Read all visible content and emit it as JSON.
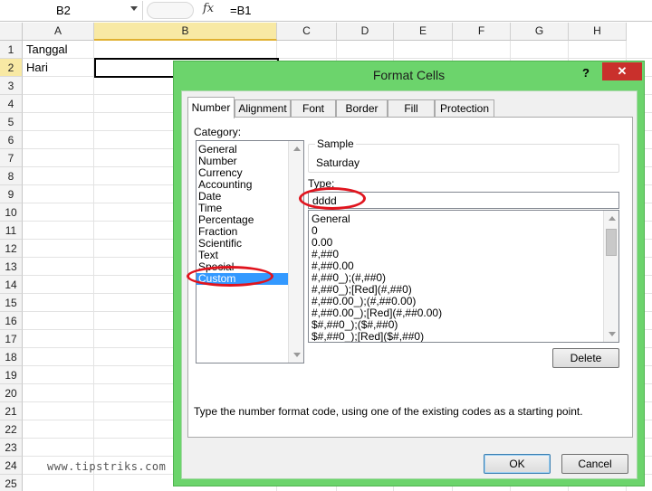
{
  "formula_bar": {
    "name_box": "B2",
    "fx_icon": "fx",
    "formula": "=B1"
  },
  "grid": {
    "columns": [
      "A",
      "B",
      "C",
      "D",
      "E",
      "F",
      "G",
      "H"
    ],
    "selected_column": "B",
    "rows": [
      "1",
      "2",
      "3",
      "4",
      "5",
      "6",
      "7",
      "8",
      "9",
      "10",
      "11",
      "12",
      "13",
      "14",
      "15",
      "16",
      "17",
      "18",
      "19",
      "20",
      "21",
      "22",
      "23",
      "24",
      "25"
    ],
    "selected_row": "2",
    "cells": {
      "A1": "Tanggal",
      "A2": "Hari"
    },
    "watermark": "www.tipstriks.com"
  },
  "dialog": {
    "title": "Format Cells",
    "help_label": "?",
    "close_label": "✕",
    "tabs": [
      "Number",
      "Alignment",
      "Font",
      "Border",
      "Fill",
      "Protection"
    ],
    "active_tab": "Number",
    "category_label": "Category:",
    "categories": [
      "General",
      "Number",
      "Currency",
      "Accounting",
      "Date",
      "Time",
      "Percentage",
      "Fraction",
      "Scientific",
      "Text",
      "Special",
      "Custom"
    ],
    "selected_category": "Custom",
    "sample_label": "Sample",
    "sample_value": "Saturday",
    "type_label": "Type:",
    "type_value": "dddd",
    "formats": [
      "General",
      "0",
      "0.00",
      "#,##0",
      "#,##0.00",
      "#,##0_);(#,##0)",
      "#,##0_);[Red](#,##0)",
      "#,##0.00_);(#,##0.00)",
      "#,##0.00_);[Red](#,##0.00)",
      "$#,##0_);($#,##0)",
      "$#,##0_);[Red]($#,##0)"
    ],
    "delete_label": "Delete",
    "description": "Type the number format code, using one of the existing codes as a starting point.",
    "ok_label": "OK",
    "cancel_label": "Cancel"
  },
  "annotation_color": "#e0141e",
  "dialog_frame_color": "#6cd46c",
  "selection_color": "#3399ff"
}
